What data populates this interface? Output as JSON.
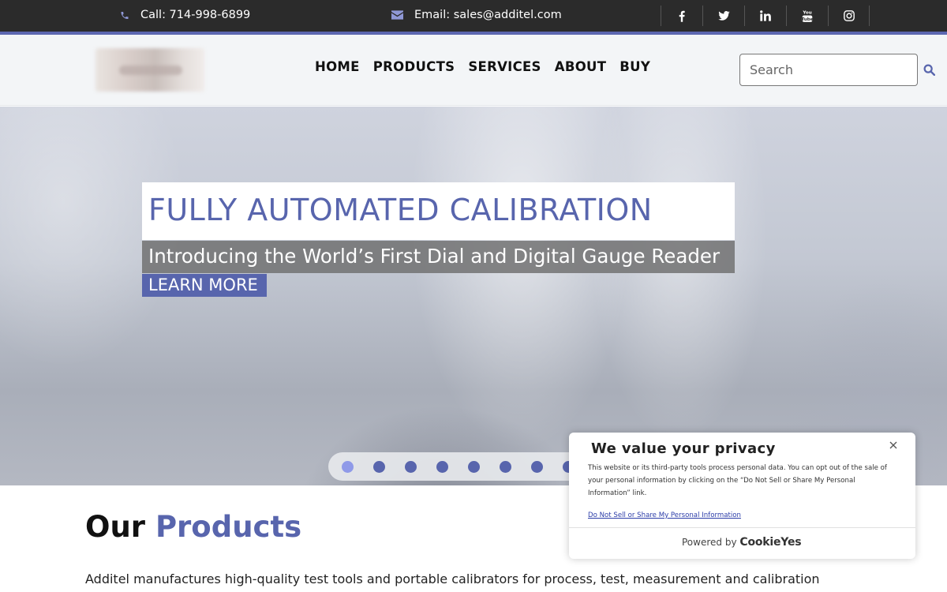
{
  "topbar": {
    "phone_text": "Call: 714-998-6899",
    "email_text": "Email: sales@additel.com",
    "phone_icon": "phone-icon",
    "email_icon": "envelope-icon",
    "social": [
      {
        "name": "facebook-icon"
      },
      {
        "name": "twitter-icon"
      },
      {
        "name": "linkedin-icon",
        "label": "in"
      },
      {
        "name": "youtube-icon",
        "label": "You Tube"
      },
      {
        "name": "instagram-icon"
      }
    ],
    "accent_color": "#5c67b0"
  },
  "header": {
    "nav": [
      {
        "label": "HOME"
      },
      {
        "label": "PRODUCTS"
      },
      {
        "label": "SERVICES"
      },
      {
        "label": "ABOUT"
      },
      {
        "label": "BUY"
      }
    ],
    "search_placeholder": "Search",
    "search_icon": "search-icon"
  },
  "hero": {
    "title": "FULLY AUTOMATED CALIBRATION",
    "subtitle": "Introducing the World’s First Dial and Digital Gauge Reader",
    "cta_label": "LEARN MORE",
    "slides_visible": 8,
    "active_slide": 1,
    "brand_color": "#5865ad"
  },
  "products": {
    "heading_plain": "Our",
    "heading_accent": "Products",
    "intro": "Additel manufactures high-quality test tools and portable calibrators for process, test, measurement and calibration applications."
  },
  "cookie_banner": {
    "title": "We value your privacy",
    "body": "This website or its third-party tools process personal data. You can opt out of the sale of your personal information by clicking on the “Do Not Sell or Share My Personal Information” link.",
    "link_label": "Do Not Sell or Share My Personal Information",
    "powered_by": "Powered by",
    "brand": "CookieYes",
    "close_icon": "close-icon"
  }
}
